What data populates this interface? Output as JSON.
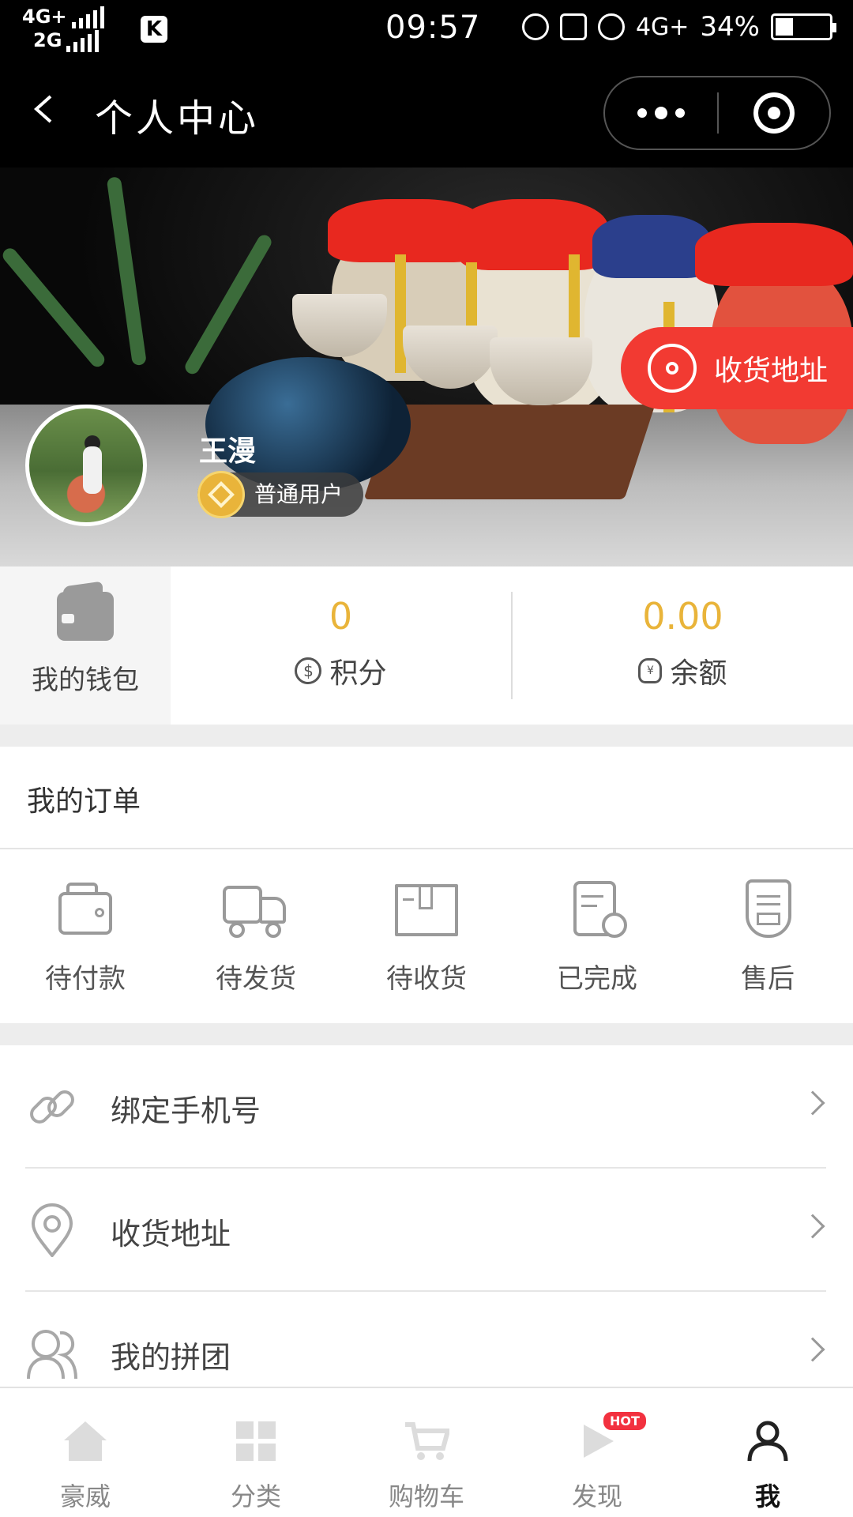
{
  "status_bar": {
    "network_top": "4G+",
    "network_bottom": "2G",
    "app_badge": "K",
    "time": "09:57",
    "network_right": "4G+",
    "battery": "34%",
    "battery_level": 0.34
  },
  "nav": {
    "title": "个人中心"
  },
  "profile": {
    "name": "王漫",
    "level": "普通用户",
    "address_button": "收货地址"
  },
  "stats": {
    "wallet_label": "我的钱包",
    "points_value": "0",
    "points_label": "积分",
    "points_icon": "$",
    "balance_value": "0.00",
    "balance_label": "余额",
    "balance_icon": "¥"
  },
  "orders": {
    "title": "我的订单",
    "items": [
      {
        "label": "待付款",
        "icon": "wallet-icon"
      },
      {
        "label": "待发货",
        "icon": "truck-icon"
      },
      {
        "label": "待收货",
        "icon": "package-icon"
      },
      {
        "label": "已完成",
        "icon": "document-check-icon"
      },
      {
        "label": "售后",
        "icon": "after-sale-shield-icon"
      }
    ]
  },
  "menu": {
    "items": [
      {
        "label": "绑定手机号",
        "icon": "link-icon"
      },
      {
        "label": "收货地址",
        "icon": "location-pin-icon"
      },
      {
        "label": "我的拼团",
        "icon": "group-icon"
      }
    ]
  },
  "tabbar": {
    "items": [
      {
        "label": "豪威",
        "icon": "home-icon",
        "active": false
      },
      {
        "label": "分类",
        "icon": "category-grid-icon",
        "active": false
      },
      {
        "label": "购物车",
        "icon": "cart-icon",
        "active": false
      },
      {
        "label": "发现",
        "icon": "play-icon",
        "active": false,
        "badge": "HOT"
      },
      {
        "label": "我",
        "icon": "user-icon",
        "active": true
      }
    ]
  },
  "colors": {
    "accent_red": "#f23a32",
    "value_gold": "#e9b43a",
    "hot_badge": "#f2313f"
  }
}
